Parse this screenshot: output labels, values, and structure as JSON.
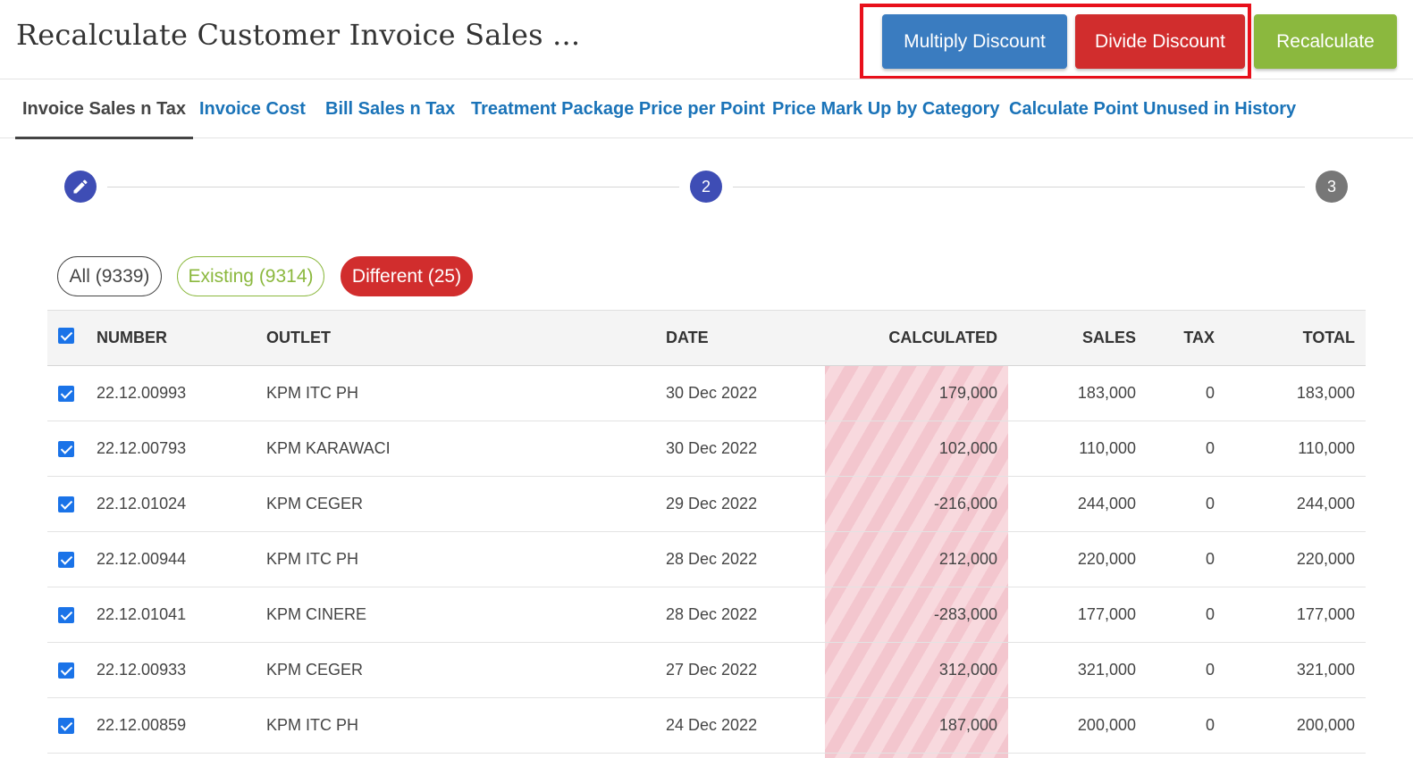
{
  "page": {
    "title": "Recalculate Customer Invoice Sales ..."
  },
  "toolbar": {
    "multiply_label": "Multiply Discount",
    "divide_label": "Divide Discount",
    "recalculate_label": "Recalculate"
  },
  "tabs": [
    {
      "label": "Invoice Sales n Tax",
      "active": true
    },
    {
      "label": "Invoice Cost",
      "active": false
    },
    {
      "label": "Bill Sales n Tax",
      "active": false
    },
    {
      "label": "Treatment Package Price per Point",
      "active": false
    },
    {
      "label": "Price Mark Up by Category",
      "active": false
    },
    {
      "label": "Calculate Point Unused in History",
      "active": false
    }
  ],
  "stepper": {
    "step1_icon": "pencil-icon",
    "step2_label": "2",
    "step3_label": "3"
  },
  "filters": {
    "all": "All (9339)",
    "existing": "Existing (9314)",
    "different": "Different (25)",
    "selected": "different"
  },
  "table": {
    "headers": {
      "number": "NUMBER",
      "outlet": "OUTLET",
      "date": "DATE",
      "calculated": "CALCULATED",
      "sales": "SALES",
      "tax": "TAX",
      "total": "TOTAL"
    },
    "rows": [
      {
        "number": "22.12.00993",
        "outlet": "KPM ITC PH",
        "date": "30 Dec 2022",
        "calculated": "179,000",
        "sales": "183,000",
        "tax": "0",
        "total": "183,000"
      },
      {
        "number": "22.12.00793",
        "outlet": "KPM KARAWACI",
        "date": "30 Dec 2022",
        "calculated": "102,000",
        "sales": "110,000",
        "tax": "0",
        "total": "110,000"
      },
      {
        "number": "22.12.01024",
        "outlet": "KPM CEGER",
        "date": "29 Dec 2022",
        "calculated": "-216,000",
        "sales": "244,000",
        "tax": "0",
        "total": "244,000"
      },
      {
        "number": "22.12.00944",
        "outlet": "KPM ITC PH",
        "date": "28 Dec 2022",
        "calculated": "212,000",
        "sales": "220,000",
        "tax": "0",
        "total": "220,000"
      },
      {
        "number": "22.12.01041",
        "outlet": "KPM CINERE",
        "date": "28 Dec 2022",
        "calculated": "-283,000",
        "sales": "177,000",
        "tax": "0",
        "total": "177,000"
      },
      {
        "number": "22.12.00933",
        "outlet": "KPM CEGER",
        "date": "27 Dec 2022",
        "calculated": "312,000",
        "sales": "321,000",
        "tax": "0",
        "total": "321,000"
      },
      {
        "number": "22.12.00859",
        "outlet": "KPM ITC PH",
        "date": "24 Dec 2022",
        "calculated": "187,000",
        "sales": "200,000",
        "tax": "0",
        "total": "200,000"
      }
    ]
  },
  "colors": {
    "multiply": "#3a7cc0",
    "divide": "#d12d2d",
    "recalculate": "#8bb83e",
    "highlight": "#e8101b",
    "tab_link": "#1a73b8",
    "step_active": "#3e4db5",
    "step_inactive": "#777777"
  }
}
